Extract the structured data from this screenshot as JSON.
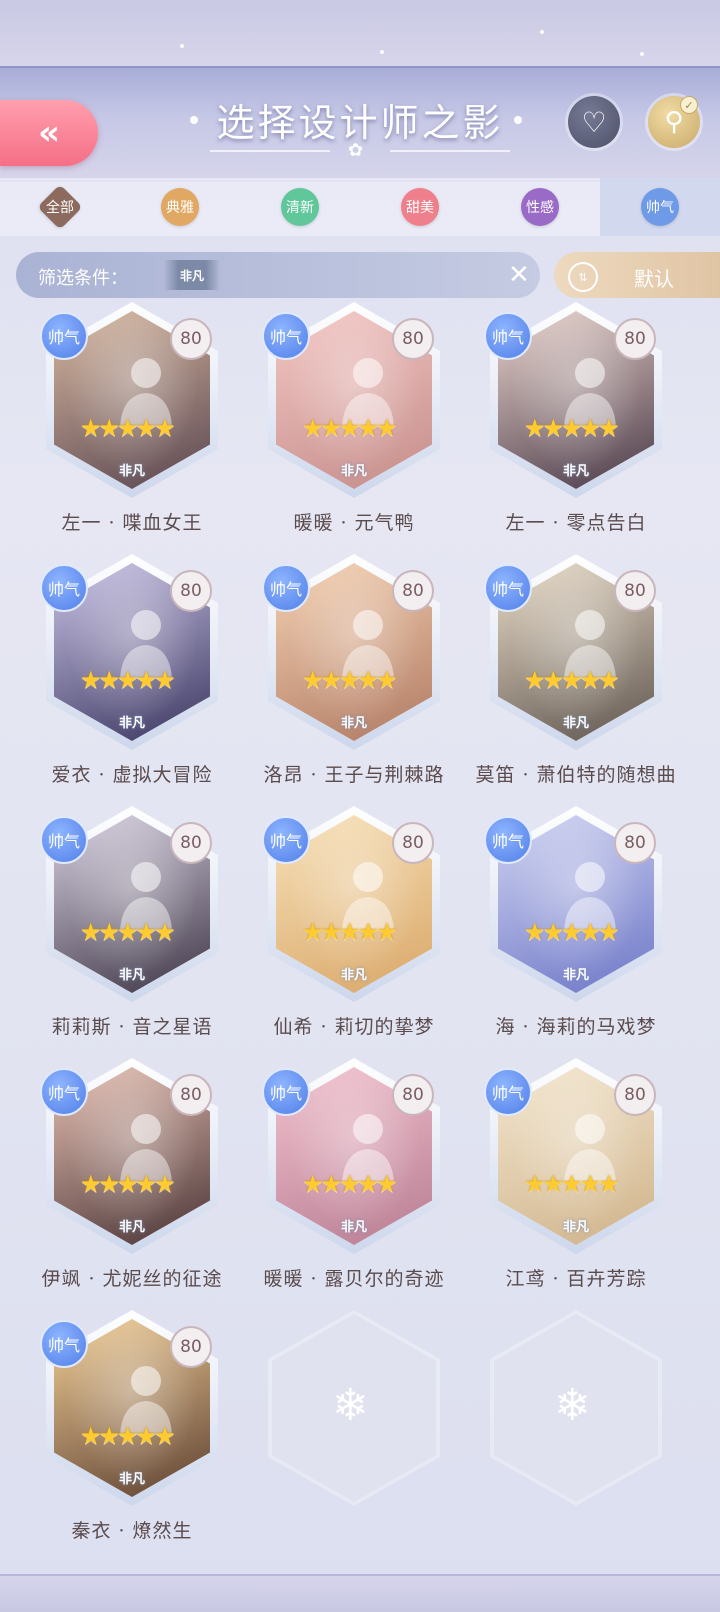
{
  "header": {
    "title": "选择设计师之影",
    "back_icon": "double-chevron-left-icon",
    "favorite_icon": "heart-icon",
    "search_icon": "search-icon",
    "search_check_icon": "check-icon",
    "back_glyph": "«",
    "favorite_glyph": "♡",
    "search_glyph": "⚲",
    "check_glyph": "✓"
  },
  "tabs": [
    {
      "label": "全部",
      "color": "#8c6a5e"
    },
    {
      "label": "典雅",
      "color": "#e0a862"
    },
    {
      "label": "清新",
      "color": "#5fc79a"
    },
    {
      "label": "甜美",
      "color": "#f07f8c"
    },
    {
      "label": "性感",
      "color": "#9a6ac7"
    },
    {
      "label": "帅气",
      "color": "#6e9ae8"
    }
  ],
  "filter": {
    "label": "筛选条件：",
    "tag": "非凡",
    "clear_glyph": "✕"
  },
  "sort": {
    "label": "默认",
    "icon_glyph": "⇅"
  },
  "cards": [
    {
      "name": "左一 · 喋血女王",
      "tag": "帅气",
      "level": "80",
      "stars": "★★★★★",
      "rarity": "非凡",
      "c1": "#d7b8a0",
      "c2": "#5a4650"
    },
    {
      "name": "暖暖 · 元气鸭",
      "tag": "帅气",
      "level": "80",
      "stars": "★★★★★",
      "rarity": "非凡",
      "c1": "#f3c7c4",
      "c2": "#c58d8a"
    },
    {
      "name": "左一 · 零点告白",
      "tag": "帅气",
      "level": "80",
      "stars": "★★★★★",
      "rarity": "非凡",
      "c1": "#e9d3cc",
      "c2": "#4a3a48"
    },
    {
      "name": "爱衣 · 虚拟大冒险",
      "tag": "帅气",
      "level": "80",
      "stars": "★★★★★",
      "rarity": "非凡",
      "c1": "#c9c3e6",
      "c2": "#3c3760"
    },
    {
      "name": "洛昂 · 王子与荆棘路",
      "tag": "帅气",
      "level": "80",
      "stars": "★★★★★",
      "rarity": "非凡",
      "c1": "#f4d1b2",
      "c2": "#b07a63"
    },
    {
      "name": "莫笛 · 萧伯特的随想曲",
      "tag": "帅气",
      "level": "80",
      "stars": "★★★★★",
      "rarity": "非凡",
      "c1": "#e9dbc7",
      "c2": "#5f564f"
    },
    {
      "name": "莉莉斯 · 音之星语",
      "tag": "帅气",
      "level": "80",
      "stars": "★★★★★",
      "rarity": "非凡",
      "c1": "#d8d1e3",
      "c2": "#3f3746"
    },
    {
      "name": "仙希 · 莉切的挚梦",
      "tag": "帅气",
      "level": "80",
      "stars": "★★★★★",
      "rarity": "非凡",
      "c1": "#f7e1b9",
      "c2": "#d9a768"
    },
    {
      "name": "海 · 海莉的马戏梦",
      "tag": "帅气",
      "level": "80",
      "stars": "★★★★★",
      "rarity": "非凡",
      "c1": "#cfd3f1",
      "c2": "#6e77c7"
    },
    {
      "name": "伊飒 · 尤妮丝的征途",
      "tag": "帅气",
      "level": "80",
      "stars": "★★★★★",
      "rarity": "非凡",
      "c1": "#e7c0b3",
      "c2": "#4a3536"
    },
    {
      "name": "暖暖 · 露贝尔的奇迹",
      "tag": "帅气",
      "level": "80",
      "stars": "★★★★★",
      "rarity": "非凡",
      "c1": "#f2c2cf",
      "c2": "#b87d92"
    },
    {
      "name": "江鸢 · 百卉芳踪",
      "tag": "帅气",
      "level": "80",
      "stars": "★★★★★",
      "rarity": "非凡",
      "c1": "#f3e6cf",
      "c2": "#cfb38a"
    },
    {
      "name": "秦衣 · 燎然生",
      "tag": "帅气",
      "level": "80",
      "stars": "★★★★★",
      "rarity": "非凡",
      "c1": "#f2cf97",
      "c2": "#5e4132"
    }
  ],
  "empty_slot": {
    "icon": "snowflake-icon",
    "glyph": "❄"
  }
}
